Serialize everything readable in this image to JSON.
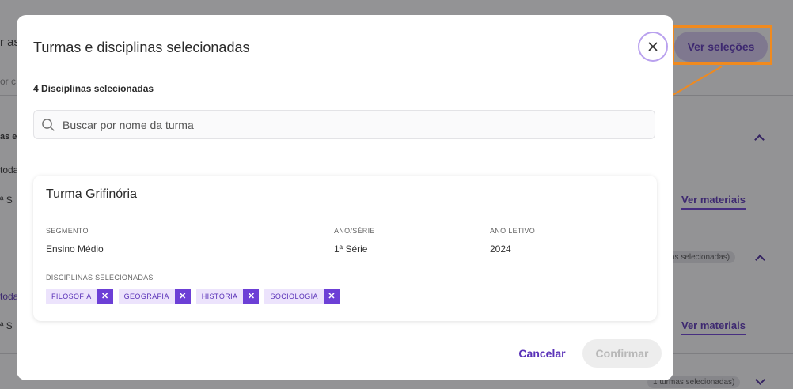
{
  "background": {
    "left_fragments": [
      "r as",
      "or c",
      "as e",
      "toda",
      "ª S",
      "toda",
      "ª S"
    ],
    "ver_materiais_label": "Ver materiais",
    "pill_1": "as selecionadas)",
    "pill_2": "1 turmas selecionadas)",
    "ver_selecoes_label": "Ver seleções"
  },
  "modal": {
    "title": "Turmas e disciplinas selecionadas",
    "count_text": "4 Disciplinas selecionadas",
    "search": {
      "placeholder": "Buscar por nome da turma",
      "value": ""
    },
    "card": {
      "title": "Turma Grifinória",
      "fields": [
        {
          "label": "SEGMENTO",
          "value": "Ensino Médio"
        },
        {
          "label": "ANO/SÉRIE",
          "value": "1ª Série"
        },
        {
          "label": "ANO LETIVO",
          "value": "2024"
        }
      ],
      "disciplines_label": "DISCIPLINAS SELECIONADAS",
      "disciplines": [
        "FILOSOFIA",
        "GEOGRAFIA",
        "HISTÓRIA",
        "SOCIOLOGIA"
      ],
      "remove_glyph": "✕"
    },
    "cancel_label": "Cancelar",
    "confirm_label": "Confirmar"
  },
  "colors": {
    "accent": "#6c3fd6",
    "annotation": "#f08a1e",
    "tag_bg": "#ece3fc"
  },
  "icons": {
    "close": "close-icon",
    "search": "search-icon",
    "remove": "close-icon",
    "chevron": "chevron-icon"
  }
}
